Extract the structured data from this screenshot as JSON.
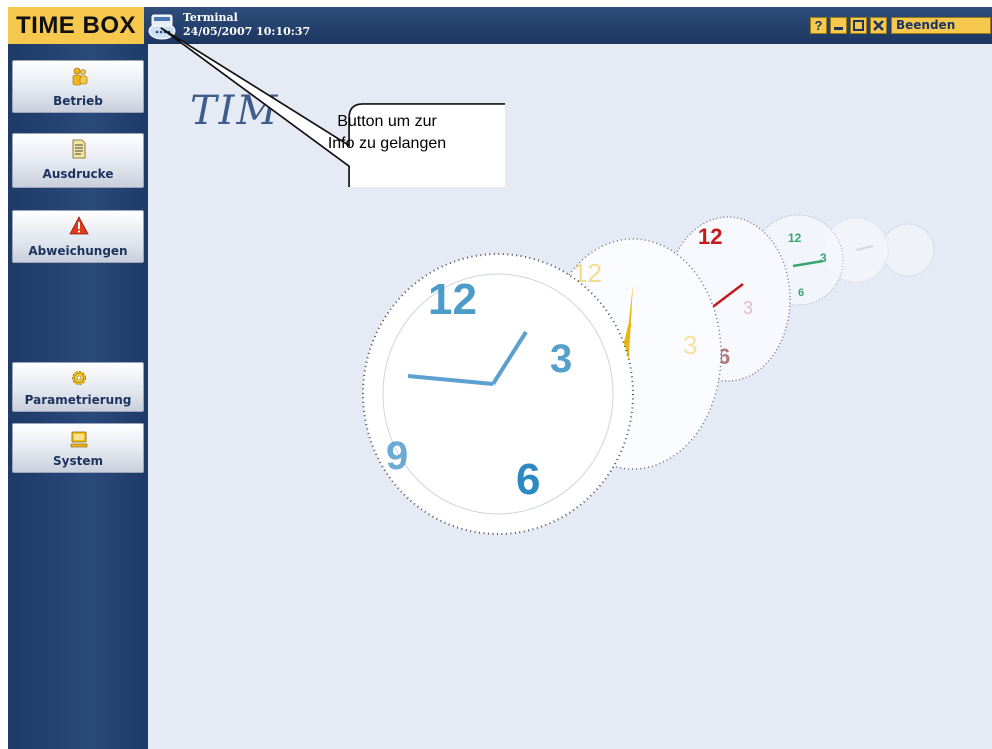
{
  "app": {
    "logo": "TIME BOX",
    "terminal_label": "Terminal",
    "datetime": "24/05/2007 10:10:37"
  },
  "window_controls": {
    "help": "?",
    "exit_label": "Beenden"
  },
  "sidebar": {
    "items": [
      {
        "label": "Betrieb",
        "icon": "people-icon"
      },
      {
        "label": "Ausdrucke",
        "icon": "document-icon"
      },
      {
        "label": "Abweichungen",
        "icon": "warning-icon"
      },
      {
        "label": "Parametrierung",
        "icon": "gear-icon"
      },
      {
        "label": "System",
        "icon": "computer-icon"
      }
    ]
  },
  "main": {
    "background_title": "TIM"
  },
  "callout": {
    "text_line1": "Button um zur",
    "text_line2": "Info zu gelangen"
  },
  "colors": {
    "accent": "#f6c94e",
    "sidebar": "#1d3a68",
    "background": "#e6eaf4"
  }
}
